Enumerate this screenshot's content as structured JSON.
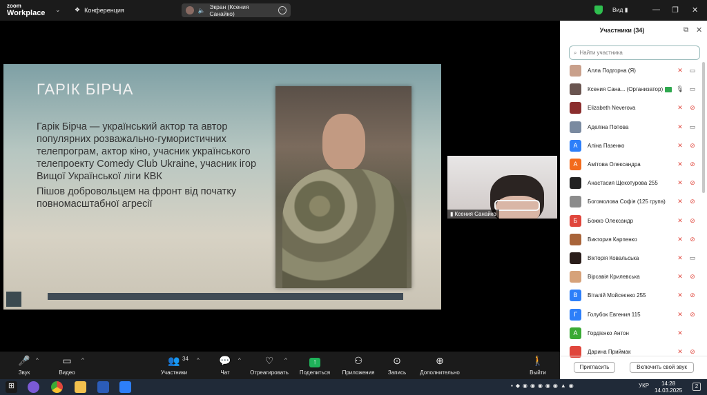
{
  "app": {
    "brand_top": "zoom",
    "brand_bottom": "Workplace",
    "conference_label": "Конференция"
  },
  "screen_share": {
    "label": "Экран (Ксения Санайко)"
  },
  "view_label": "Вид",
  "slide": {
    "title": "ГАРІК БІРЧА",
    "paragraph1": "Гарік Бірча — український актор та автор популярних розважально-гумористичних телепрограм, актор кіно, учасник українського телепроекту Comedy Club Ukraine, учасник ігор Вищої Української ліги КВК",
    "paragraph2": "Пішов добровольцем на фронт від початку повномасштабної агресії"
  },
  "video_tile": {
    "name": "Ксения Санайко"
  },
  "participants": {
    "title": "Участники (34)",
    "search_placeholder": "Найти участника",
    "items": [
      {
        "name": "Алла Подгорна (Я)",
        "color": "#c9a08b",
        "initial": "",
        "mic": "muted",
        "cam": "on"
      },
      {
        "name": "Ксения Сана... (Организатор)",
        "color": "#6a5550",
        "initial": "",
        "mic": "on",
        "cam": "on",
        "host": true
      },
      {
        "name": "Elizabeth Neverova",
        "color": "#8b2e2e",
        "initial": "",
        "mic": "muted",
        "cam": "off"
      },
      {
        "name": "Аделіна Попова",
        "color": "#7a8aa0",
        "initial": "",
        "mic": "muted",
        "cam": "on"
      },
      {
        "name": "Аліна Пазенко",
        "color": "#2d7ff9",
        "initial": "А",
        "mic": "muted",
        "cam": "off"
      },
      {
        "name": "Амітова Олександра",
        "color": "#f26b1d",
        "initial": "А",
        "mic": "muted",
        "cam": "off"
      },
      {
        "name": "Анастасия Щекотурова 255",
        "color": "#222222",
        "initial": "",
        "mic": "muted",
        "cam": "off"
      },
      {
        "name": "Богомолова Софія (125 група)",
        "color": "#8c8c8c",
        "initial": "",
        "mic": "muted",
        "cam": "off"
      },
      {
        "name": "Божко Олександр",
        "color": "#e0463c",
        "initial": "Б",
        "mic": "muted",
        "cam": "off"
      },
      {
        "name": "Виктория Карпенко",
        "color": "#a8643a",
        "initial": "",
        "mic": "muted",
        "cam": "off"
      },
      {
        "name": "Вікторія Ковальська",
        "color": "#2a1d1a",
        "initial": "",
        "mic": "muted",
        "cam": "on"
      },
      {
        "name": "Вірсавія Крилевська",
        "color": "#d6a27a",
        "initial": "",
        "mic": "muted",
        "cam": "off"
      },
      {
        "name": "Віталій Мойсеєнко 255",
        "color": "#2d7ff9",
        "initial": "В",
        "mic": "muted",
        "cam": "off"
      },
      {
        "name": "Голубок Евгения 115",
        "color": "#2d7ff9",
        "initial": "Г",
        "mic": "muted",
        "cam": "off"
      },
      {
        "name": "Гордієнко Антон",
        "color": "#3aaa35",
        "initial": "А",
        "mic": "muted",
        "cam": "none"
      },
      {
        "name": "Дарина Приймак",
        "color": "#e0463c",
        "initial": "",
        "mic": "muted",
        "cam": "off"
      }
    ],
    "invite_label": "Пригласить",
    "unmute_label": "Включить свой звук"
  },
  "toolbar": {
    "audio": "Звук",
    "video": "Видео",
    "participants": "Участники",
    "participants_count": "34",
    "chat": "Чат",
    "react": "Отреагировать",
    "share": "Поделиться",
    "apps": "Приложения",
    "record": "Запись",
    "more": "Дополнительно",
    "leave": "Выйти"
  },
  "taskbar": {
    "lang": "УКР",
    "time": "14:28",
    "date": "14.03.2025",
    "notif_count": "2"
  }
}
